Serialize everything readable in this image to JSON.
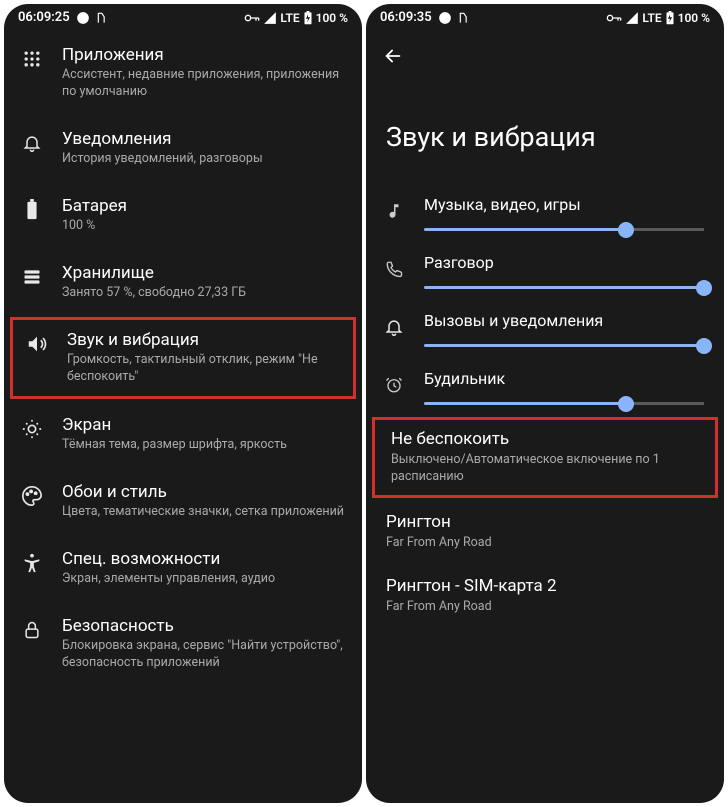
{
  "left": {
    "statusTime": "06:09:25",
    "statusNet": "LTE",
    "statusBattery": "100 %",
    "items": [
      {
        "icon": "apps",
        "title": "Приложения",
        "subtitle": "Ассистент, недавние приложения, приложения по умолчанию"
      },
      {
        "icon": "bell",
        "title": "Уведомления",
        "subtitle": "История уведомлений, разговоры"
      },
      {
        "icon": "battery",
        "title": "Батарея",
        "subtitle": "100 %"
      },
      {
        "icon": "storage",
        "title": "Хранилище",
        "subtitle": "Занято 57 %, свободно 27,33 ГБ"
      },
      {
        "icon": "sound",
        "title": "Звук и вибрация",
        "subtitle": "Громкость, тактильный отклик, режим \"Не беспокоить\"",
        "highlighted": true
      },
      {
        "icon": "display",
        "title": "Экран",
        "subtitle": "Тёмная тема, размер шрифта, яркость"
      },
      {
        "icon": "palette",
        "title": "Обои и стиль",
        "subtitle": "Цвета, тематические значки, сетка приложений"
      },
      {
        "icon": "accessibility",
        "title": "Спец. возможности",
        "subtitle": "Экран, элементы управления, аудио"
      },
      {
        "icon": "lock",
        "title": "Безопасность",
        "subtitle": "Блокировка экрана, сервис \"Найти устройство\", безопасность приложений"
      }
    ]
  },
  "right": {
    "statusTime": "06:09:35",
    "statusNet": "LTE",
    "statusBattery": "100 %",
    "pageTitle": "Звук и вибрация",
    "sliders": [
      {
        "icon": "music",
        "label": "Музыка, видео, игры",
        "value": 72
      },
      {
        "icon": "phone",
        "label": "Разговор",
        "value": 100
      },
      {
        "icon": "bell",
        "label": "Вызовы и уведомления",
        "value": 100
      },
      {
        "icon": "alarm",
        "label": "Будильник",
        "value": 72
      }
    ],
    "dnd": {
      "title": "Не беспокоить",
      "subtitle": "Выключено/Автоматическое включение по 1 расписанию"
    },
    "ringtone1": {
      "title": "Рингтон",
      "subtitle": "Far From Any Road"
    },
    "ringtone2": {
      "title": "Рингтон - SIM-карта 2",
      "subtitle": "Far From Any Road"
    }
  }
}
